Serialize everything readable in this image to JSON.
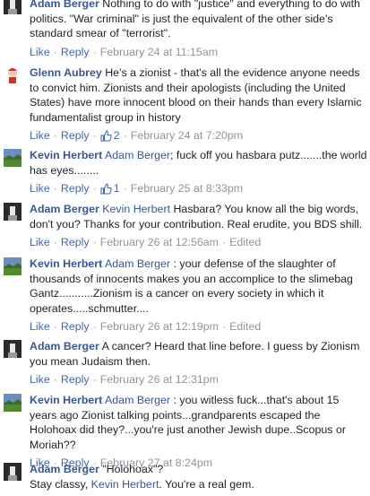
{
  "actions": {
    "like": "Like",
    "reply": "Reply",
    "dot": "·",
    "edited": "Edited"
  },
  "comments": [
    {
      "author": "",
      "text": "Nothing to do with \"justice\" and everything to do with politics. \"War criminal\" is just the equivalent of the other side's standard smear of \"terrorist\".",
      "likes": "",
      "timestamp": "February 24 at 11:15am",
      "edited": false,
      "avatar": "dark-avatar"
    },
    {
      "author": "Glenn Aubrey",
      "text": "He's a zionist - that's all the evidence anyone needs to convict him. Zionists and their apologists (including the United States) have more innocent blood on their hands than every Islamic fundamentalist group in history",
      "likes": "2",
      "timestamp": "February 24 at 7:20pm",
      "edited": false,
      "avatar": "cartoon-avatar"
    },
    {
      "author": "Kevin Herbert",
      "mention": "Adam Berger",
      "text": "; fuck off you hasbara putz.......the world has eyes........",
      "likes": "1",
      "timestamp": "February 25 at 8:33pm",
      "edited": false,
      "avatar": "landscape-avatar"
    },
    {
      "author": "Adam Berger",
      "mention": "Kevin Herbert",
      "text": "Hasbara? You know all the big words, don't you? Thanks for your contribution. Real erudite, you BDS shill.",
      "likes": "",
      "timestamp": "February 26 at 12:56am",
      "edited": true,
      "avatar": "dark-avatar"
    },
    {
      "author": "Kevin Herbert",
      "mention": "Adam Berger",
      "text": ": your defense of the slaughter of thousands of innocents makes you an accomplice to the slimebag Gantz...........Zionism is a cancer on every society in which it operates.....schmutter....",
      "likes": "",
      "timestamp": "February 26 at 12:19pm",
      "edited": true,
      "avatar": "landscape-avatar"
    },
    {
      "author": "Adam Berger",
      "text": "A cancer? Heard that line before. I guess by Zionism you mean Judaism then.",
      "likes": "",
      "timestamp": "February 26 at 12:31pm",
      "edited": false,
      "avatar": "dark-avatar"
    },
    {
      "author": "Kevin Herbert",
      "mention": "Adam Berger",
      "text": ": you witless fuck...that's about 15 years ago Zionist talking points...grandparents escaped the Holohoax did they?...you're just another Jewish dupe..Scopus or Moriah??",
      "likes": "",
      "timestamp": "February 27 at 8:24pm",
      "edited": false,
      "avatar": "landscape-avatar"
    },
    {
      "author": "Adam Berger",
      "text": "\"Holohoax\"?",
      "text2a": "Stay classy, ",
      "mention2": "Kevin Herbert",
      "text2b": ". You're a real gem.",
      "likes": "",
      "timestamp": "",
      "edited": false,
      "avatar": "dark-avatar"
    }
  ],
  "colors": {
    "link": "#365899",
    "action": "#4267b2",
    "meta": "#90949c",
    "text": "#1d2129"
  }
}
